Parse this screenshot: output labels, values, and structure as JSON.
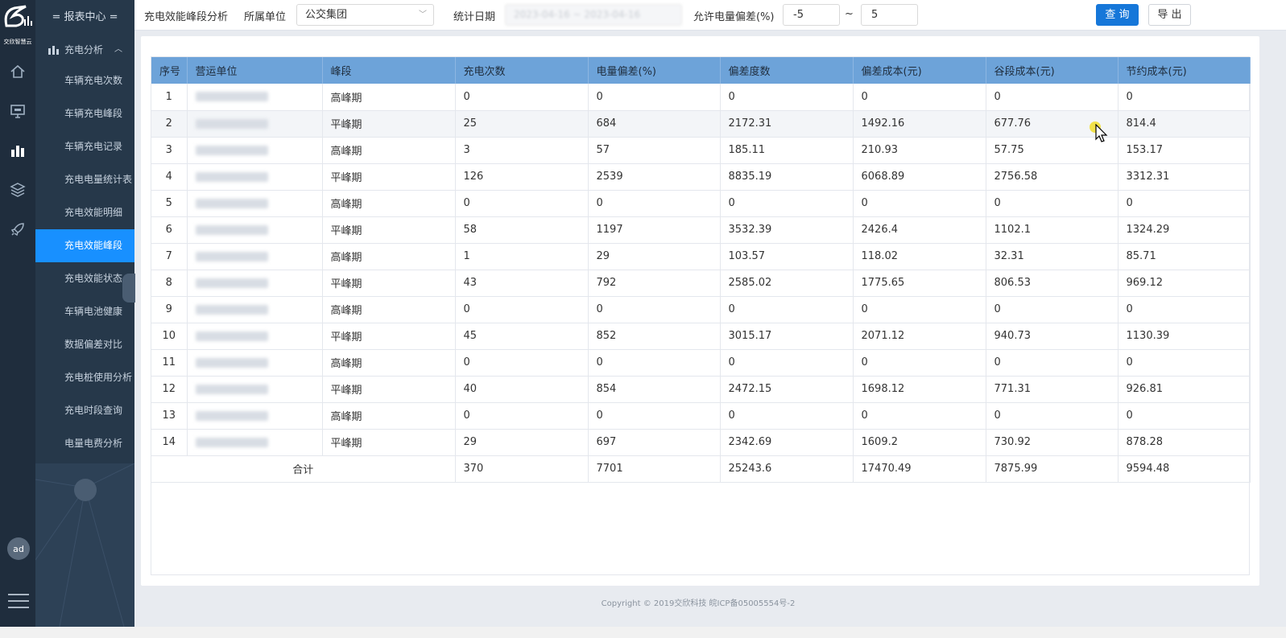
{
  "rail": {
    "logo_text": "交欣智慧云",
    "avatar": "ad",
    "icons": [
      "home-icon",
      "monitor-icon",
      "bar-chart-icon",
      "layers-icon",
      "rocket-icon"
    ]
  },
  "menu": {
    "header": "= 报表中心 =",
    "group": "充电分析",
    "items": [
      "车辆充电次数",
      "车辆充电峰段",
      "车辆充电记录",
      "充电电量统计表",
      "充电效能明细",
      "充电效能峰段",
      "充电效能状态",
      "车辆电池健康",
      "数据偏差对比",
      "充电桩使用分析",
      "充电时段查询",
      "电量电费分析"
    ],
    "active_index": 5
  },
  "toolbar": {
    "page_title": "充电效能峰段分析",
    "unit_label": "所属单位",
    "unit_value": "公交集团",
    "date_label": "统计日期",
    "date_value": "2023-04-16  ~  2023-04-16",
    "deviation_label": "允许电量偏差(%)",
    "dev_min": "-5",
    "tilde": "~",
    "dev_max": "5",
    "query_label": "查 询",
    "export_label": "导 出"
  },
  "table": {
    "headers": [
      "序号",
      "营运单位",
      "峰段",
      "充电次数",
      "电量偏差(%)",
      "偏差度数",
      "偏差成本(元)",
      "谷段成本(元)",
      "节约成本(元)"
    ],
    "rows": [
      [
        "1",
        "",
        "高峰期",
        "0",
        "0",
        "0",
        "0",
        "0",
        "0"
      ],
      [
        "2",
        "",
        "平峰期",
        "25",
        "684",
        "2172.31",
        "1492.16",
        "677.76",
        "814.4"
      ],
      [
        "3",
        "",
        "高峰期",
        "3",
        "57",
        "185.11",
        "210.93",
        "57.75",
        "153.17"
      ],
      [
        "4",
        "",
        "平峰期",
        "126",
        "2539",
        "8835.19",
        "6068.89",
        "2756.58",
        "3312.31"
      ],
      [
        "5",
        "",
        "高峰期",
        "0",
        "0",
        "0",
        "0",
        "0",
        "0"
      ],
      [
        "6",
        "",
        "平峰期",
        "58",
        "1197",
        "3532.39",
        "2426.4",
        "1102.1",
        "1324.29"
      ],
      [
        "7",
        "",
        "高峰期",
        "1",
        "29",
        "103.57",
        "118.02",
        "32.31",
        "85.71"
      ],
      [
        "8",
        "",
        "平峰期",
        "43",
        "792",
        "2585.02",
        "1775.65",
        "806.53",
        "969.12"
      ],
      [
        "9",
        "",
        "高峰期",
        "0",
        "0",
        "0",
        "0",
        "0",
        "0"
      ],
      [
        "10",
        "",
        "平峰期",
        "45",
        "852",
        "3015.17",
        "2071.12",
        "940.73",
        "1130.39"
      ],
      [
        "11",
        "",
        "高峰期",
        "0",
        "0",
        "0",
        "0",
        "0",
        "0"
      ],
      [
        "12",
        "",
        "平峰期",
        "40",
        "854",
        "2472.15",
        "1698.12",
        "771.31",
        "926.81"
      ],
      [
        "13",
        "",
        "高峰期",
        "0",
        "0",
        "0",
        "0",
        "0",
        "0"
      ],
      [
        "14",
        "",
        "平峰期",
        "29",
        "697",
        "2342.69",
        "1609.2",
        "730.92",
        "878.28"
      ]
    ],
    "total": {
      "label": "合计",
      "values": [
        "370",
        "7701",
        "25243.6",
        "17470.49",
        "7875.99",
        "9594.48"
      ]
    },
    "highlighted_row": 1
  },
  "footer": {
    "copyright": "Copyright © 2019交欣科技 皖ICP备05005554号-2"
  }
}
